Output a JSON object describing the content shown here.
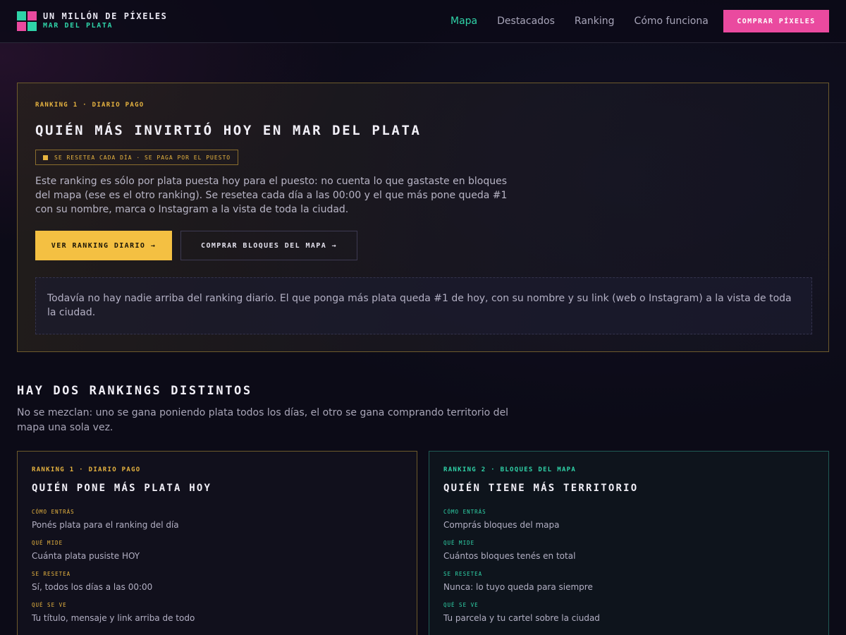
{
  "header": {
    "logo_title": "Un millón de píxeles",
    "logo_sub": "Mar del Plata",
    "nav": [
      "Mapa",
      "Destacados",
      "Ranking",
      "Cómo funciona"
    ],
    "cta": "Comprar píxeles"
  },
  "hero": {
    "kicker": "Ranking 1 · Diario pago",
    "title": "Quién más invirtió hoy en Mar del Plata",
    "badge": "Se resetea cada día · se paga por el puesto",
    "description": "Este ranking es sólo por plata puesta hoy para el puesto: no cuenta lo que gastaste en bloques del mapa (ese es el otro ranking). Se resetea cada día a las 00:00 y el que más pone queda #1 con su nombre, marca o Instagram a la vista de toda la ciudad.",
    "btn_primary": "Ver ranking diario →",
    "btn_secondary": "Comprar bloques del mapa →",
    "empty_message": "Todavía no hay nadie arriba del ranking diario. El que ponga más plata queda #1 de hoy, con su nombre y su link (web o Instagram) a la vista de toda la ciudad."
  },
  "section": {
    "title": "Hay dos rankings distintos",
    "subtitle": "No se mezclan: uno se gana poniendo plata todos los días, el otro se gana comprando territorio del mapa una sola vez."
  },
  "cards": [
    {
      "kicker": "Ranking 1 · Diario pago",
      "title": "Quién pone más plata hoy",
      "rows": [
        {
          "label": "Cómo entrás",
          "value": "Ponés plata para el ranking del día"
        },
        {
          "label": "Qué mide",
          "value": "Cuánta plata pusiste HOY"
        },
        {
          "label": "Se resetea",
          "value": "Sí, todos los días a las 00:00"
        },
        {
          "label": "Qué se ve",
          "value": "Tu título, mensaje y link arriba de todo"
        }
      ]
    },
    {
      "kicker": "Ranking 2 · Bloques del mapa",
      "title": "Quién tiene más territorio",
      "rows": [
        {
          "label": "Cómo entrás",
          "value": "Comprás bloques del mapa"
        },
        {
          "label": "Qué mide",
          "value": "Cuántos bloques tenés en total"
        },
        {
          "label": "Se resetea",
          "value": "Nunca: lo tuyo queda para siempre"
        },
        {
          "label": "Qué se ve",
          "value": "Tu parcela y tu cartel sobre la ciudad"
        }
      ]
    }
  ],
  "colors": {
    "accent_pink": "#ea4a9f",
    "accent_teal": "#2fd3a8",
    "accent_yellow": "#f4c042",
    "background": "#0c0b17"
  }
}
